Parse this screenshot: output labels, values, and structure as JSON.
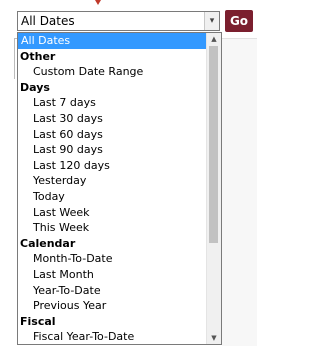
{
  "select": {
    "value": "All Dates",
    "arrow": "▾",
    "go_label": "Go"
  },
  "dropdown": {
    "options": [
      {
        "label": "All Dates",
        "kind": "option",
        "selected": true
      },
      {
        "label": "Other",
        "kind": "group"
      },
      {
        "label": "Custom Date Range",
        "kind": "option"
      },
      {
        "label": "Days",
        "kind": "group"
      },
      {
        "label": "Last 7 days",
        "kind": "option"
      },
      {
        "label": "Last 30 days",
        "kind": "option"
      },
      {
        "label": "Last 60 days",
        "kind": "option"
      },
      {
        "label": "Last 90 days",
        "kind": "option"
      },
      {
        "label": "Last 120 days",
        "kind": "option"
      },
      {
        "label": "Yesterday",
        "kind": "option"
      },
      {
        "label": "Today",
        "kind": "option"
      },
      {
        "label": "Last Week",
        "kind": "option"
      },
      {
        "label": "This Week",
        "kind": "option"
      },
      {
        "label": "Calendar",
        "kind": "group"
      },
      {
        "label": "Month-To-Date",
        "kind": "option"
      },
      {
        "label": "Last Month",
        "kind": "option"
      },
      {
        "label": "Year-To-Date",
        "kind": "option"
      },
      {
        "label": "Previous Year",
        "kind": "option"
      },
      {
        "label": "Fiscal",
        "kind": "group"
      },
      {
        "label": "Fiscal Year-To-Date",
        "kind": "option"
      }
    ],
    "scroll_up": "▲",
    "scroll_down": "▼"
  },
  "colors": {
    "go_button": "#7b1f2e",
    "selected_highlight": "#3399ff",
    "pointer_marker": "#c0392b"
  }
}
